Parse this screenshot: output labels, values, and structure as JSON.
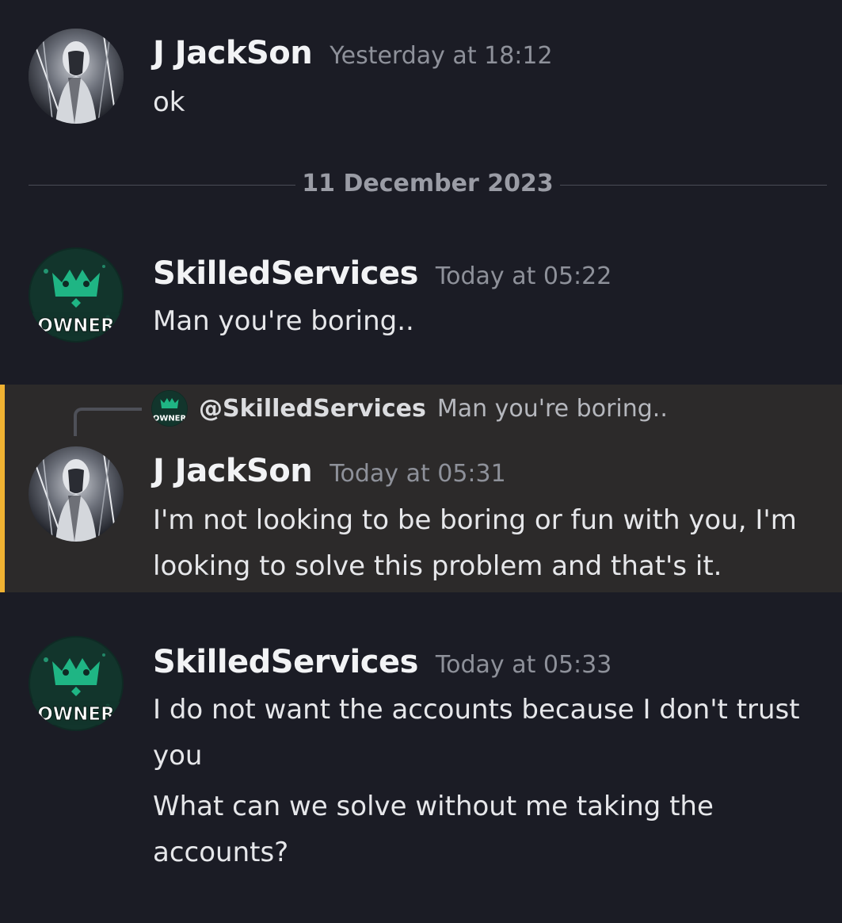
{
  "date_divider": "11 December 2023",
  "messages": [
    {
      "author": "J JackSon",
      "timestamp": "Yesterday at 18:12",
      "lines": [
        "ok"
      ]
    },
    {
      "author": "SkilledServices",
      "timestamp": "Today at 05:22",
      "avatar_badge": "OWNER",
      "lines": [
        "Man you're boring.."
      ]
    },
    {
      "author": "J JackSon",
      "timestamp": "Today at 05:31",
      "reply": {
        "mention": "@SkilledServices",
        "preview": "Man you're boring..",
        "avatar_badge": "OWNER"
      },
      "lines": [
        "I'm not looking to be boring or fun with you, I'm looking to solve this problem and that's it."
      ],
      "highlight_color": "#f0b232"
    },
    {
      "author": "SkilledServices",
      "timestamp": "Today at 05:33",
      "avatar_badge": "OWNER",
      "lines": [
        "I do not want the accounts because I don't trust you",
        "What can we solve without me taking the accounts?"
      ]
    }
  ],
  "colors": {
    "background": "#1b1c25",
    "mention_highlight": "#2c2a2a",
    "mention_bar": "#f0b232",
    "owner_green": "#1fb584"
  }
}
